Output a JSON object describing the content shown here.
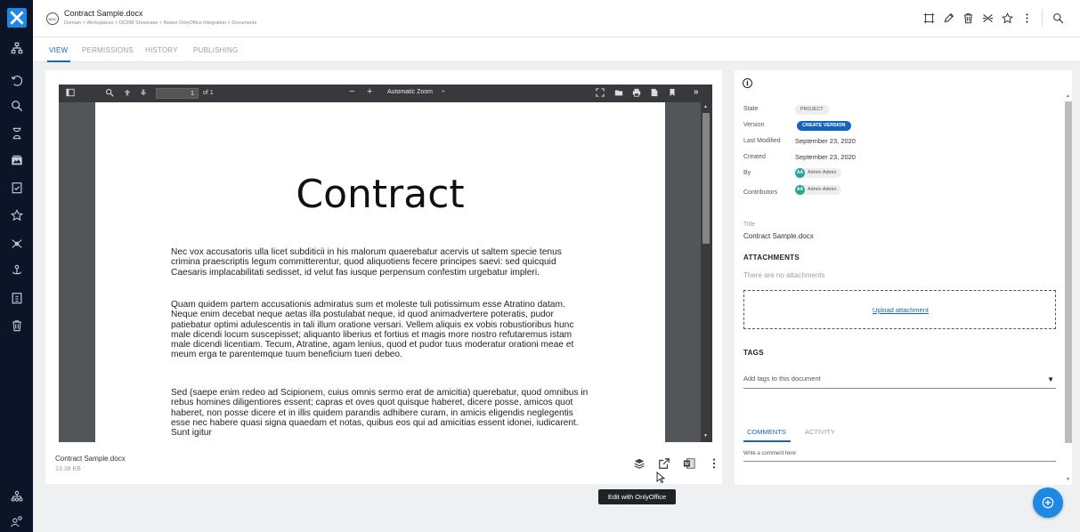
{
  "app": {
    "doc_title": "Contract Sample.docx",
    "doc_icon_text": "DOC",
    "breadcrumb": "Domain > Workspaces > OCDM Showcase > Nuxeo OnlyOffice Integration > Documents"
  },
  "top_actions": [
    "select-icon",
    "edit-icon",
    "trash-icon",
    "compare-icon",
    "star-icon",
    "more-icon",
    "search-icon"
  ],
  "tabs": [
    {
      "label": "VIEW",
      "active": true
    },
    {
      "label": "PERMISSIONS",
      "active": false
    },
    {
      "label": "HISTORY",
      "active": false
    },
    {
      "label": "PUBLISHING",
      "active": false
    }
  ],
  "viewer": {
    "page_number": "1",
    "page_of": "of 1",
    "zoom": "Automatic Zoom",
    "zoom_arrow": "÷"
  },
  "pdf": {
    "title": "Contract",
    "paragraphs": [
      "Nec vox accusatoris ulla licet subditicii in his malorum quaerebatur acervis ut saltem specie tenus crimina praescriptis legum committerentur, quod aliquotiens fecere principes saevi: sed quicquid Caesaris implacabilitati sedisset, id velut fas iusque perpensum confestim urgebatur impleri.",
      "Quam quidem partem accusationis admiratus sum et moleste tuli potissimum esse Atratino datam. Neque enim decebat neque aetas illa postulabat neque, id quod animadvertere poteratis, pudor patiebatur optimi adulescentis in tali illum oratione versari. Vellem aliquis ex vobis robustioribus hunc male dicendi locum suscepisset; aliquanto liberius et fortius et magis more nostro refutaremus istam male dicendi licentiam. Tecum, Atratine, agam lenius, quod et pudor tuus moderatur orationi meae et meum erga te parentemque tuum beneficium tueri debeo.",
      "Sed (saepe enim redeo ad Scipionem, cuius omnis sermo erat de amicitia) querebatur, quod omnibus in rebus homines diligentiores essent; capras et oves quot quisque haberet, dicere posse, amicos quot haberet, non posse dicere et in illis quidem parandis adhibere curam, in amicis eligendis neglegentis esse nec habere quasi signa quaedam et notas, quibus eos qui ad amicitias essent idonei, iudicarent. Sunt igitur"
    ]
  },
  "file": {
    "name": "Contract Sample.docx",
    "size": "13.38 KB",
    "tooltip": "Edit with OnlyOffice"
  },
  "info": {
    "state_label": "State",
    "state_value": "PROJECT",
    "version_label": "Version",
    "version_button": "CREATE VERSION",
    "last_modified_label": "Last Modified",
    "last_modified_value": "September 23, 2020",
    "created_label": "Created",
    "created_value": "September 23, 2020",
    "by_label": "By",
    "by_user": "Admin Admin",
    "by_initials": "AA",
    "contributors_label": "Contributors",
    "contributor_user": "Admin Admin",
    "contributor_initials": "AA",
    "title_label": "Title",
    "title_value": "Contract Sample.docx",
    "attachments_heading": "ATTACHMENTS",
    "no_attachments": "There are no attachments",
    "upload_link": "Upload attachment",
    "tags_heading": "TAGS",
    "tags_placeholder": "Add tags to this document",
    "tags_arrow": "▼",
    "comments_tab": "COMMENTS",
    "activity_tab": "ACTIVITY",
    "comment_placeholder": "Write a comment here"
  },
  "colors": {
    "nav_bg": "#0b1527",
    "accent": "#1565c0",
    "fab": "#1e88e5",
    "avatar": "#26a69a"
  }
}
